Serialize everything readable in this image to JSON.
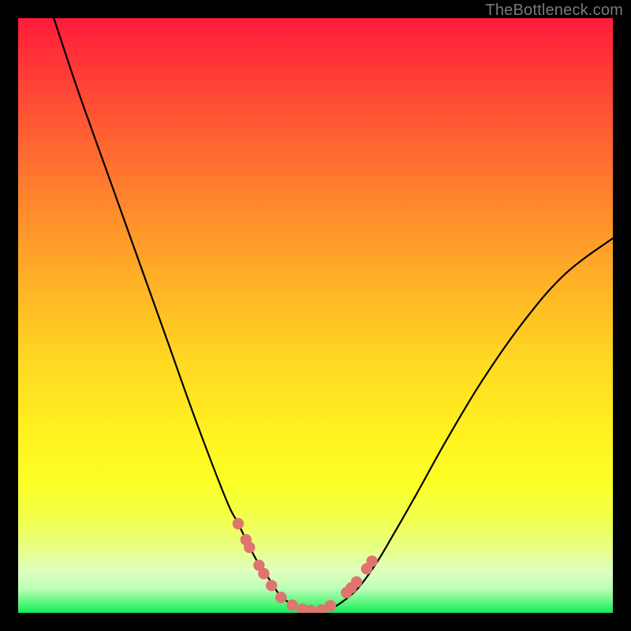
{
  "watermark": "TheBottleneck.com",
  "colors": {
    "frame": "#000000",
    "curve_stroke": "#000000",
    "dot_fill": "#e0746f",
    "gradient_top": "#ff1a3a",
    "gradient_bottom": "#12e662"
  },
  "chart_data": {
    "type": "line",
    "title": "",
    "xlabel": "",
    "ylabel": "",
    "xlim": [
      0,
      100
    ],
    "ylim": [
      0,
      100
    ],
    "note": "Bottleneck-style V curve. Y is read as height from bottom (0 at bottom, 100 at top). Values estimated from pixels; no axis ticks present in source.",
    "series": [
      {
        "name": "bottleneck-curve",
        "x": [
          6,
          10,
          15,
          20,
          25,
          30,
          35,
          37,
          40,
          42,
          44,
          46,
          48,
          50,
          52,
          54,
          57,
          60,
          63,
          67,
          72,
          78,
          85,
          92,
          100
        ],
        "y": [
          100,
          88,
          74,
          60,
          46,
          32,
          19,
          15,
          9,
          6,
          3,
          1.5,
          0.6,
          0.3,
          0.6,
          1.5,
          4,
          8,
          13,
          20,
          29,
          39,
          49,
          57,
          63
        ]
      }
    ],
    "markers": {
      "name": "highlight-dots",
      "x": [
        37.0,
        38.3,
        38.9,
        40.5,
        41.3,
        42.6,
        44.2,
        46.1,
        47.8,
        49.2,
        51.0,
        52.5,
        55.2,
        56.0,
        56.9,
        58.6,
        59.5
      ],
      "y": [
        15.0,
        12.3,
        11.0,
        8.0,
        6.6,
        4.6,
        2.6,
        1.3,
        0.6,
        0.4,
        0.5,
        1.2,
        3.4,
        4.2,
        5.2,
        7.4,
        8.7
      ]
    }
  }
}
